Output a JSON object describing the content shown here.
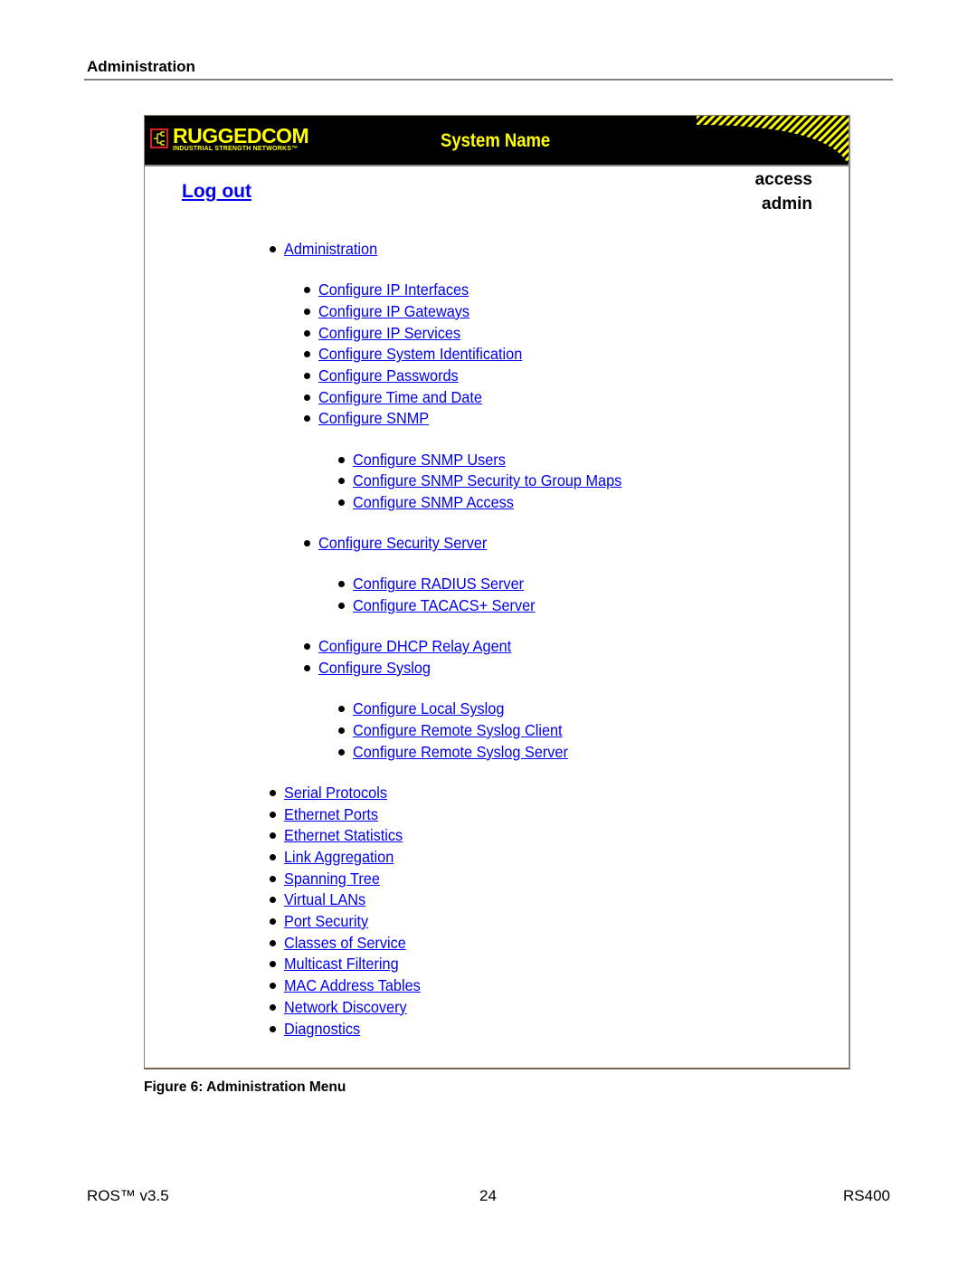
{
  "page": {
    "section_header": "Administration",
    "caption": "Figure 6: Administration Menu",
    "footer": {
      "left": "ROS™  v3.5",
      "center": "24",
      "right": "RS400"
    }
  },
  "app": {
    "brand": {
      "name": "RUGGEDCOM",
      "tagline": "INDUSTRIAL STRENGTH NETWORKS™",
      "logo_icon": "network-tree-icon",
      "colors": {
        "banner_bg": "#000000",
        "brand_yellow": "#ffff00",
        "logo_border": "#e02020"
      }
    },
    "system_name": "System Name",
    "logout_label": "Log out",
    "access_label": "access",
    "access_user": "admin",
    "link_color": "#0000ee"
  },
  "menu": {
    "items": [
      {
        "label": "Administration",
        "level": 0
      },
      {
        "label": "Configure IP Interfaces",
        "level": 1
      },
      {
        "label": "Configure IP Gateways",
        "level": 1
      },
      {
        "label": "Configure IP Services",
        "level": 1
      },
      {
        "label": "Configure System Identification",
        "level": 1
      },
      {
        "label": "Configure Passwords",
        "level": 1
      },
      {
        "label": "Configure Time and Date",
        "level": 1
      },
      {
        "label": "Configure SNMP",
        "level": 1
      },
      {
        "label": "Configure SNMP Users",
        "level": 2
      },
      {
        "label": "Configure SNMP Security to Group Maps",
        "level": 2
      },
      {
        "label": "Configure SNMP Access",
        "level": 2
      },
      {
        "label": "Configure Security Server",
        "level": 1
      },
      {
        "label": "Configure RADIUS Server",
        "level": 2
      },
      {
        "label": "Configure TACACS+ Server",
        "level": 2
      },
      {
        "label": "Configure DHCP Relay Agent",
        "level": 1
      },
      {
        "label": "Configure Syslog",
        "level": 1
      },
      {
        "label": "Configure Local Syslog",
        "level": 2
      },
      {
        "label": "Configure Remote Syslog Client",
        "level": 2
      },
      {
        "label": "Configure Remote Syslog Server",
        "level": 2
      },
      {
        "label": "Serial Protocols",
        "level": 0
      },
      {
        "label": "Ethernet Ports",
        "level": 0
      },
      {
        "label": "Ethernet Statistics",
        "level": 0
      },
      {
        "label": "Link Aggregation",
        "level": 0
      },
      {
        "label": "Spanning Tree",
        "level": 0
      },
      {
        "label": "Virtual LANs",
        "level": 0
      },
      {
        "label": "Port Security",
        "level": 0
      },
      {
        "label": "Classes of Service",
        "level": 0
      },
      {
        "label": "Multicast Filtering",
        "level": 0
      },
      {
        "label": "MAC Address Tables",
        "level": 0
      },
      {
        "label": "Network Discovery",
        "level": 0
      },
      {
        "label": "Diagnostics",
        "level": 0
      }
    ]
  }
}
